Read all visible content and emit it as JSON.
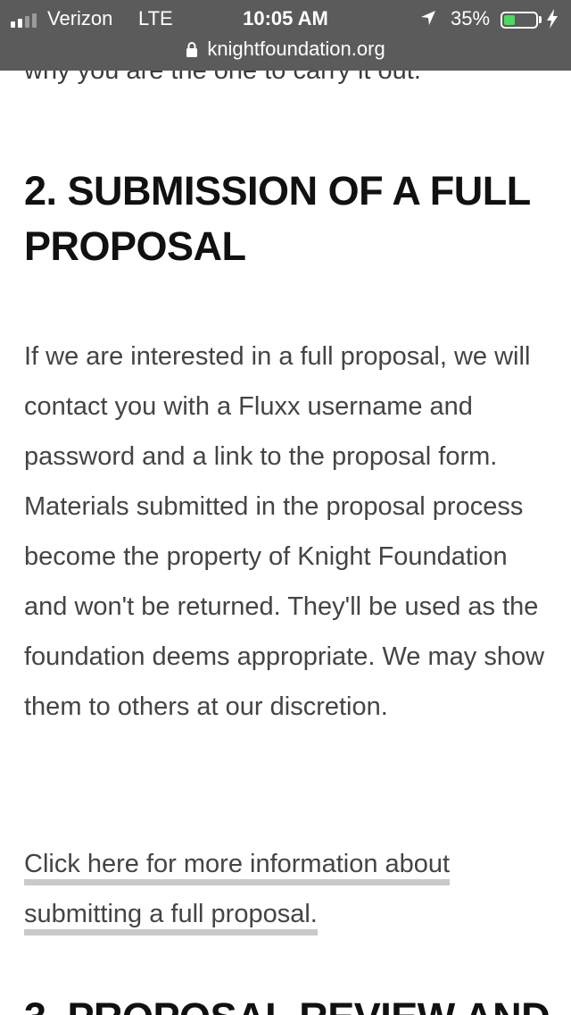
{
  "status_bar": {
    "carrier": "Verizon",
    "network": "LTE",
    "time": "10:05 AM",
    "battery_percent_label": "35%",
    "battery_level": 0.35,
    "battery_color": "#4cd964",
    "background_color": "#5b5b5b",
    "signal_bars_total": 4,
    "signal_bars_active": 2,
    "icons": [
      "signal-icon",
      "location-arrow-icon",
      "battery-icon",
      "charging-bolt-icon",
      "lock-icon"
    ]
  },
  "browser": {
    "url": "knightfoundation.org"
  },
  "article": {
    "previous_text_fragment": "why you are the one to carry it out.",
    "section_heading": "2. SUBMISSION OF A FULL PROPOSAL",
    "body": "If we are interested in a full proposal, we will contact you with a Fluxx username and password and a link to the proposal form. Materials submitted in the proposal process become the property of Knight Foundation and won't be returned. They'll be used as the foundation deems appropriate. We may show them to others at our discretion.",
    "more_info_link": "Click here for more information about submitting a full proposal.",
    "next_section_heading_partial": "3. PROPOSAL REVIEW AND"
  }
}
